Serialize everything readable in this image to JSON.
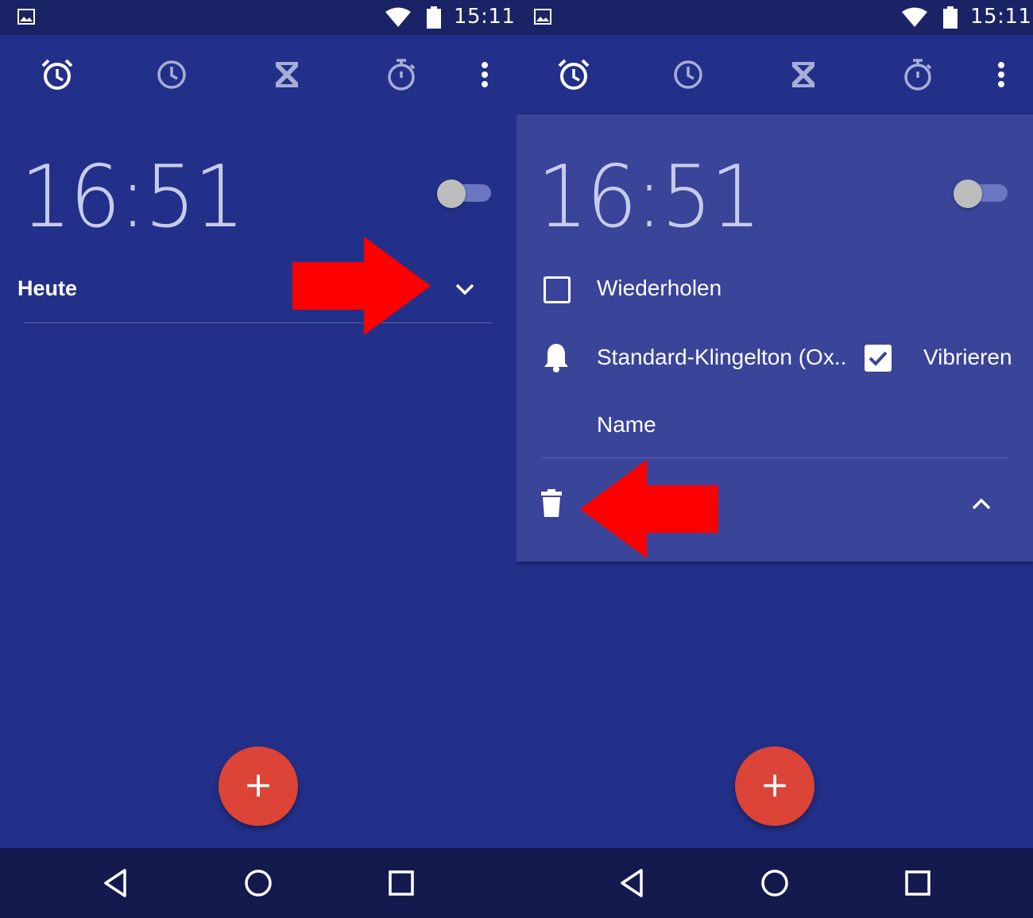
{
  "status_bar": {
    "time": "15:11"
  },
  "tabs": [
    {
      "name": "alarm-clock-icon"
    },
    {
      "name": "clock-icon"
    },
    {
      "name": "hourglass-icon"
    },
    {
      "name": "stopwatch-icon"
    },
    {
      "name": "more-vert-icon"
    }
  ],
  "left_screen": {
    "alarm": {
      "time": "16:51",
      "enabled": false,
      "day_label": "Heute"
    }
  },
  "right_screen": {
    "alarm": {
      "time": "16:51",
      "enabled": false,
      "repeat_label": "Wiederholen",
      "repeat_checked": false,
      "ringtone_label": "Standard-Klingelton (Ox..",
      "vibrate_label": "Vibrieren",
      "vibrate_checked": true,
      "name_label": "Name"
    }
  },
  "fab": {
    "label": "+"
  },
  "colors": {
    "background": "#233089",
    "status_bar": "#1A2366",
    "card": "#3A4499",
    "fab": "#DB4437",
    "nav_bar": "#141A4E",
    "annotation_arrow": "#FF0000"
  }
}
